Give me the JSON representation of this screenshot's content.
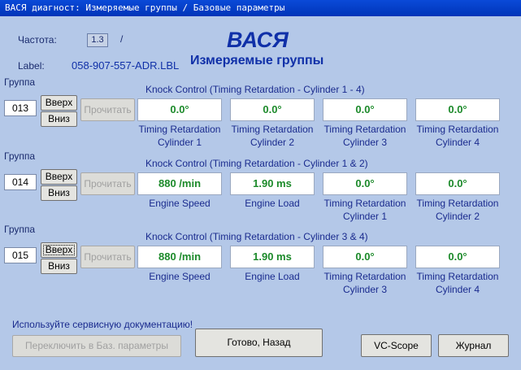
{
  "window": {
    "title": "ВАСЯ диагност: Измеряемые группы / Базовые параметры"
  },
  "header": {
    "freq_label": "Частота:",
    "freq_value": "1.3",
    "freq_slash": "/",
    "label_label": "Label:",
    "label_value": "058-907-557-ADR.LBL",
    "logo": "ВАСЯ",
    "subtitle": "Измеряемые группы"
  },
  "group_label": "Группа",
  "up_label": "Вверх",
  "down_label": "Вниз",
  "read_label": "Прочитать",
  "groups": [
    {
      "number": "013",
      "title": "Knock Control (Timing Retardation - Cylinder 1 - 4)",
      "cells": [
        {
          "value": "0.0°",
          "line1": "Timing Retardation",
          "line2": "Cylinder 1"
        },
        {
          "value": "0.0°",
          "line1": "Timing Retardation",
          "line2": "Cylinder 2"
        },
        {
          "value": "0.0°",
          "line1": "Timing Retardation",
          "line2": "Cylinder 3"
        },
        {
          "value": "0.0°",
          "line1": "Timing Retardation",
          "line2": "Cylinder 4"
        }
      ]
    },
    {
      "number": "014",
      "title": "Knock Control (Timing Retardation - Cylinder 1 & 2)",
      "cells": [
        {
          "value": "880 /min",
          "line1": "Engine Speed",
          "line2": ""
        },
        {
          "value": "1.90 ms",
          "line1": "Engine Load",
          "line2": ""
        },
        {
          "value": "0.0°",
          "line1": "Timing Retardation",
          "line2": "Cylinder 1"
        },
        {
          "value": "0.0°",
          "line1": "Timing Retardation",
          "line2": "Cylinder 2"
        }
      ]
    },
    {
      "number": "015",
      "title": "Knock Control (Timing Retardation - Cylinder 3 & 4)",
      "cells": [
        {
          "value": "880 /min",
          "line1": "Engine Speed",
          "line2": ""
        },
        {
          "value": "1.90 ms",
          "line1": "Engine Load",
          "line2": ""
        },
        {
          "value": "0.0°",
          "line1": "Timing Retardation",
          "line2": "Cylinder 3"
        },
        {
          "value": "0.0°",
          "line1": "Timing Retardation",
          "line2": "Cylinder 4"
        }
      ]
    }
  ],
  "footer": {
    "warning": "Используйте сервисную документацию!",
    "switch_label": "Переключить в Баз. параметры",
    "done_label": "Готово, Назад",
    "vcscope_label": "VC-Scope",
    "journal_label": "Журнал"
  }
}
